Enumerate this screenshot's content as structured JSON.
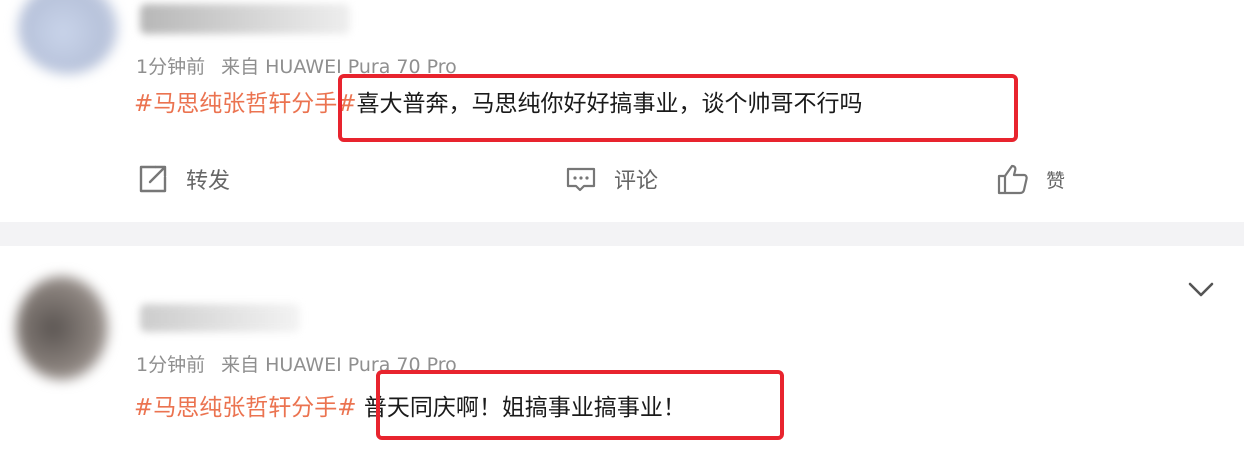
{
  "posts": [
    {
      "meta": {
        "time": "1分钟前",
        "source": "来自 HUAWEI Pura 70 Pro"
      },
      "content": {
        "hashtag": "#马思纯张哲轩分手#",
        "text": "喜大普奔，马思纯你好好搞事业，谈个帅哥不行吗"
      },
      "actions": {
        "repost": "转发",
        "comment": "评论",
        "like": "赞"
      }
    },
    {
      "meta": {
        "time": "1分钟前",
        "source": "来自 HUAWEI Pura 70 Pro"
      },
      "content": {
        "hashtag": "#马思纯张哲轩分手#",
        "text": "普天同庆啊！姐搞事业搞事业！"
      }
    }
  ],
  "colors": {
    "hashtag": "#eb7350",
    "highlight_border": "#e8242e",
    "meta_text": "#8f8f8f",
    "divider": "#f3f3f5"
  },
  "icons": [
    "repost-icon",
    "comment-icon",
    "like-icon",
    "chevron-down-icon"
  ]
}
